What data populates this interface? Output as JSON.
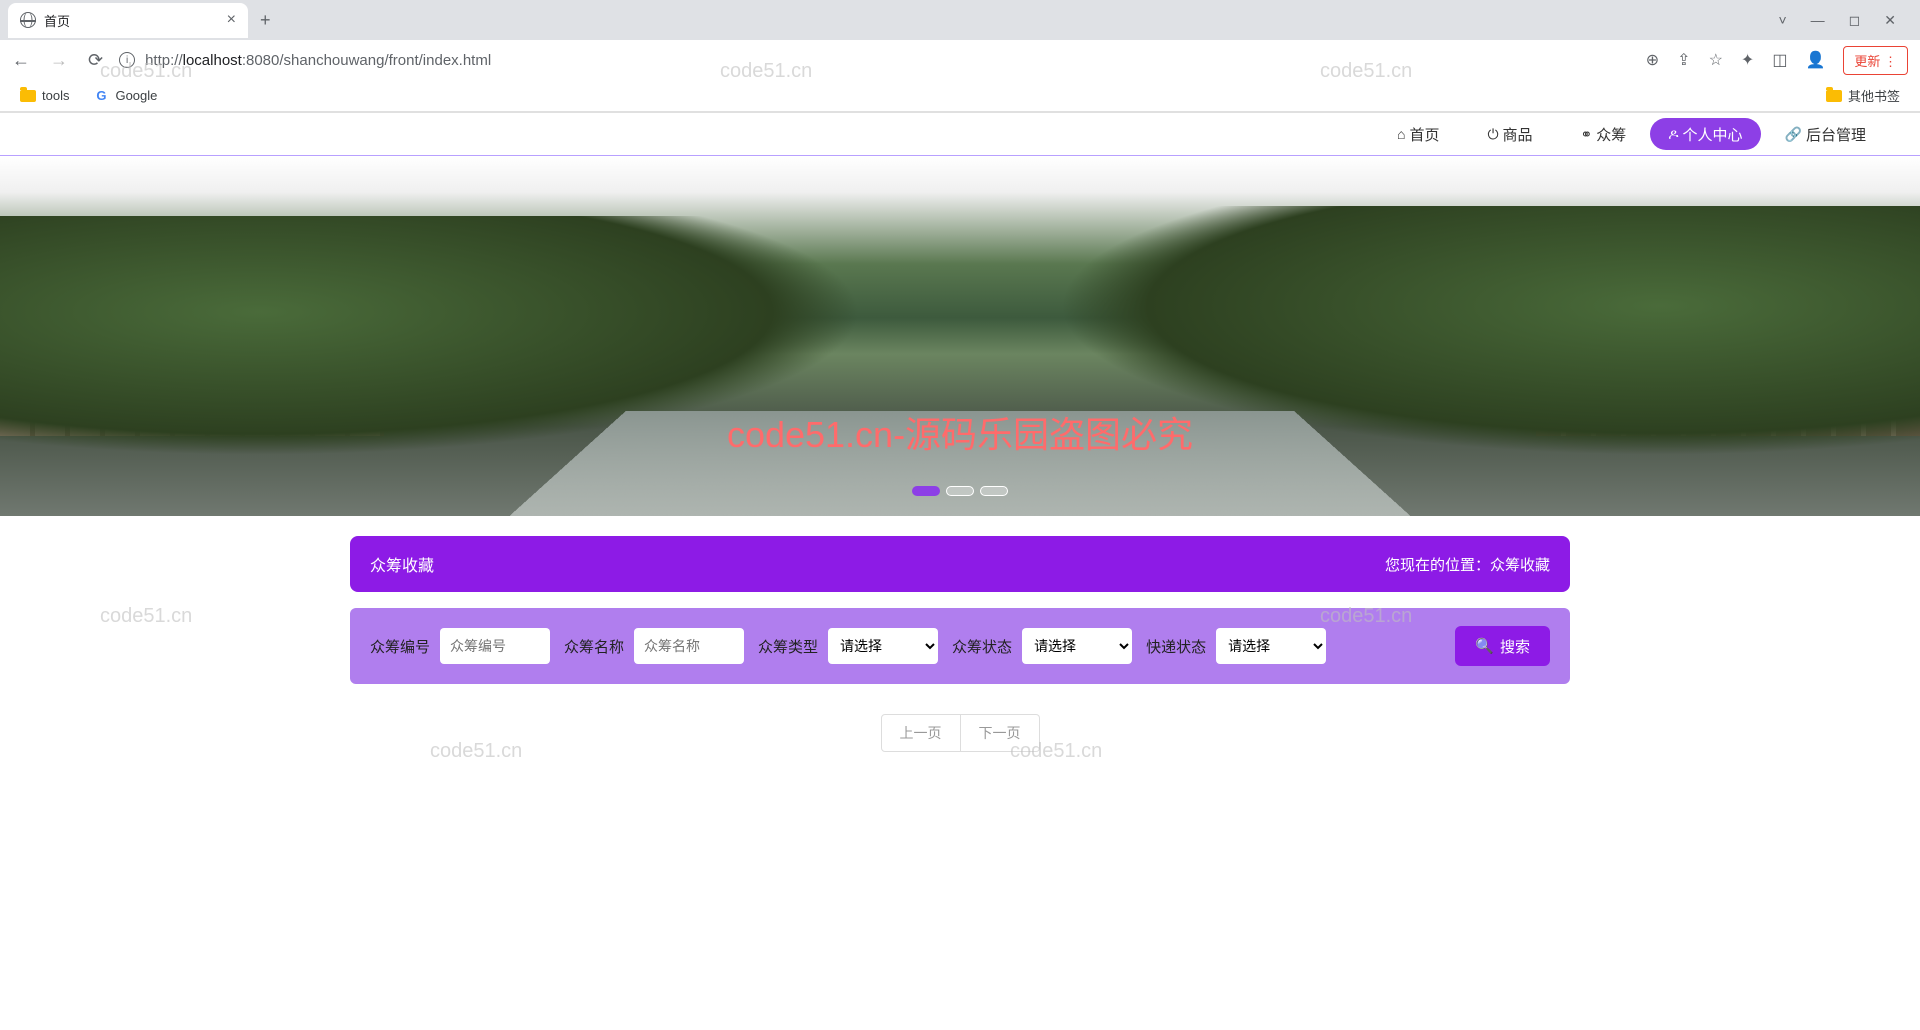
{
  "browser": {
    "tab_title": "首页",
    "new_tab": "+",
    "url_host": "localhost",
    "url_port": ":8080",
    "url_path": "/shanchouwang/front/index.html",
    "url_prefix": "http://",
    "update_label": "更新",
    "bookmarks": {
      "tools": "tools",
      "google": "Google",
      "other": "其他书签"
    }
  },
  "nav": {
    "home": "首页",
    "goods": "商品",
    "crowd": "众筹",
    "personal": "个人中心",
    "admin": "后台管理"
  },
  "hero": {
    "watermark_text": "code51.cn-源码乐园盗图必究"
  },
  "page": {
    "title": "众筹收藏",
    "breadcrumb_prefix": "您现在的位置：",
    "breadcrumb_current": "众筹收藏"
  },
  "filters": {
    "id_label": "众筹编号",
    "id_placeholder": "众筹编号",
    "name_label": "众筹名称",
    "name_placeholder": "众筹名称",
    "type_label": "众筹类型",
    "type_placeholder": "请选择",
    "status_label": "众筹状态",
    "status_placeholder": "请选择",
    "delivery_label": "快递状态",
    "delivery_placeholder": "请选择",
    "search_label": "搜索"
  },
  "pagination": {
    "prev": "上一页",
    "next": "下一页"
  },
  "watermarks": [
    "code51.cn",
    "code51.cn",
    "code51.cn",
    "code51.cn",
    "code51.cn",
    "code51.cn",
    "code51.cn",
    "code51.cn"
  ]
}
